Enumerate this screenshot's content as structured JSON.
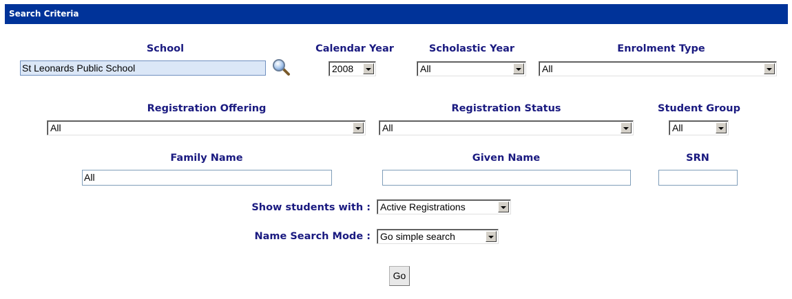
{
  "title": "Search Criteria",
  "school": {
    "label": "School",
    "value": "St Leonards Public School"
  },
  "calendar_year": {
    "label": "Calendar Year",
    "value": "2008"
  },
  "scholastic_year": {
    "label": "Scholastic Year",
    "value": "All"
  },
  "enrolment_type": {
    "label": "Enrolment Type",
    "value": "All"
  },
  "registration_offering": {
    "label": "Registration Offering",
    "value": "All"
  },
  "registration_status": {
    "label": "Registration Status",
    "value": "All"
  },
  "student_group": {
    "label": "Student Group",
    "value": "All"
  },
  "family_name": {
    "label": "Family Name",
    "value": "All"
  },
  "given_name": {
    "label": "Given Name",
    "value": ""
  },
  "srn": {
    "label": "SRN",
    "value": ""
  },
  "show_students_with": {
    "label": "Show students with :",
    "value": "Active Registrations"
  },
  "name_search_mode": {
    "label": "Name Search Mode :",
    "value": "Go simple search"
  },
  "go_label": "Go",
  "colors": {
    "title_bar": "#003399",
    "label_text": "#1a1a80",
    "school_field_bg": "#dbe7f7"
  },
  "icons": {
    "school_lookup": "magnifier-icon"
  }
}
